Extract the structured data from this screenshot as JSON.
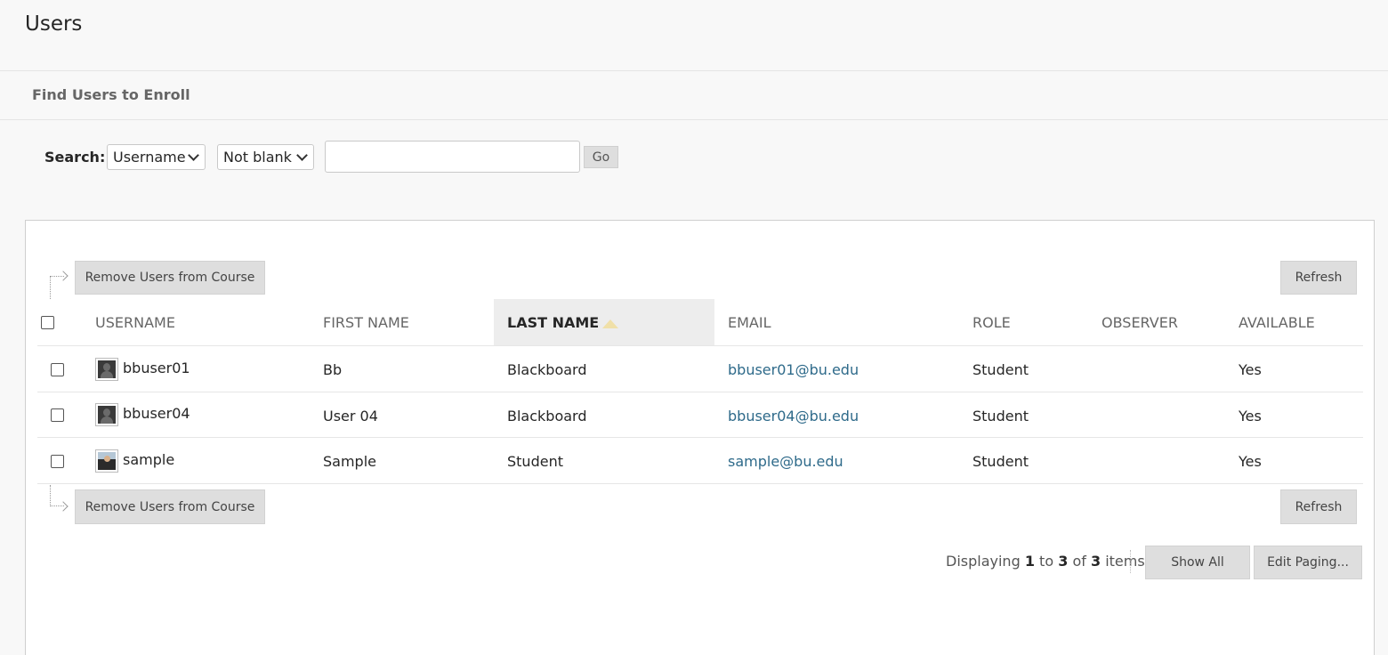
{
  "page": {
    "title": "Users",
    "find_link": "Find Users to Enroll"
  },
  "search": {
    "label": "Search:",
    "field_selected": "Username",
    "operator_selected": "Not blank",
    "value": "",
    "go_label": "Go"
  },
  "actions": {
    "remove_label": "Remove Users from Course",
    "refresh_label": "Refresh"
  },
  "table": {
    "headers": [
      "USERNAME",
      "FIRST NAME",
      "LAST NAME",
      "EMAIL",
      "ROLE",
      "OBSERVER",
      "AVAILABLE"
    ],
    "sorted_column": "LAST NAME",
    "rows": [
      {
        "username": "bbuser01",
        "first": "Bb",
        "last": "Blackboard",
        "email": "bbuser01@bu.edu",
        "role": "Student",
        "observer": "",
        "available": "Yes",
        "avatar": "default-silhouette-icon"
      },
      {
        "username": "bbuser04",
        "first": "User 04",
        "last": "Blackboard",
        "email": "bbuser04@bu.edu",
        "role": "Student",
        "observer": "",
        "available": "Yes",
        "avatar": "default-silhouette-icon"
      },
      {
        "username": "sample",
        "first": "Sample",
        "last": "Student",
        "email": "sample@bu.edu",
        "role": "Student",
        "observer": "",
        "available": "Yes",
        "avatar": "photo-avatar-icon"
      }
    ]
  },
  "paging": {
    "prefix": "Displaying",
    "from": "1",
    "to_word": "to",
    "to": "3",
    "of_word": "of",
    "total": "3",
    "suffix": "items",
    "show_all_label": "Show All",
    "edit_paging_label": "Edit Paging..."
  },
  "colors": {
    "link": "#2e6a8a",
    "button_bg": "#dedede",
    "sort_highlight": "#ededed"
  }
}
